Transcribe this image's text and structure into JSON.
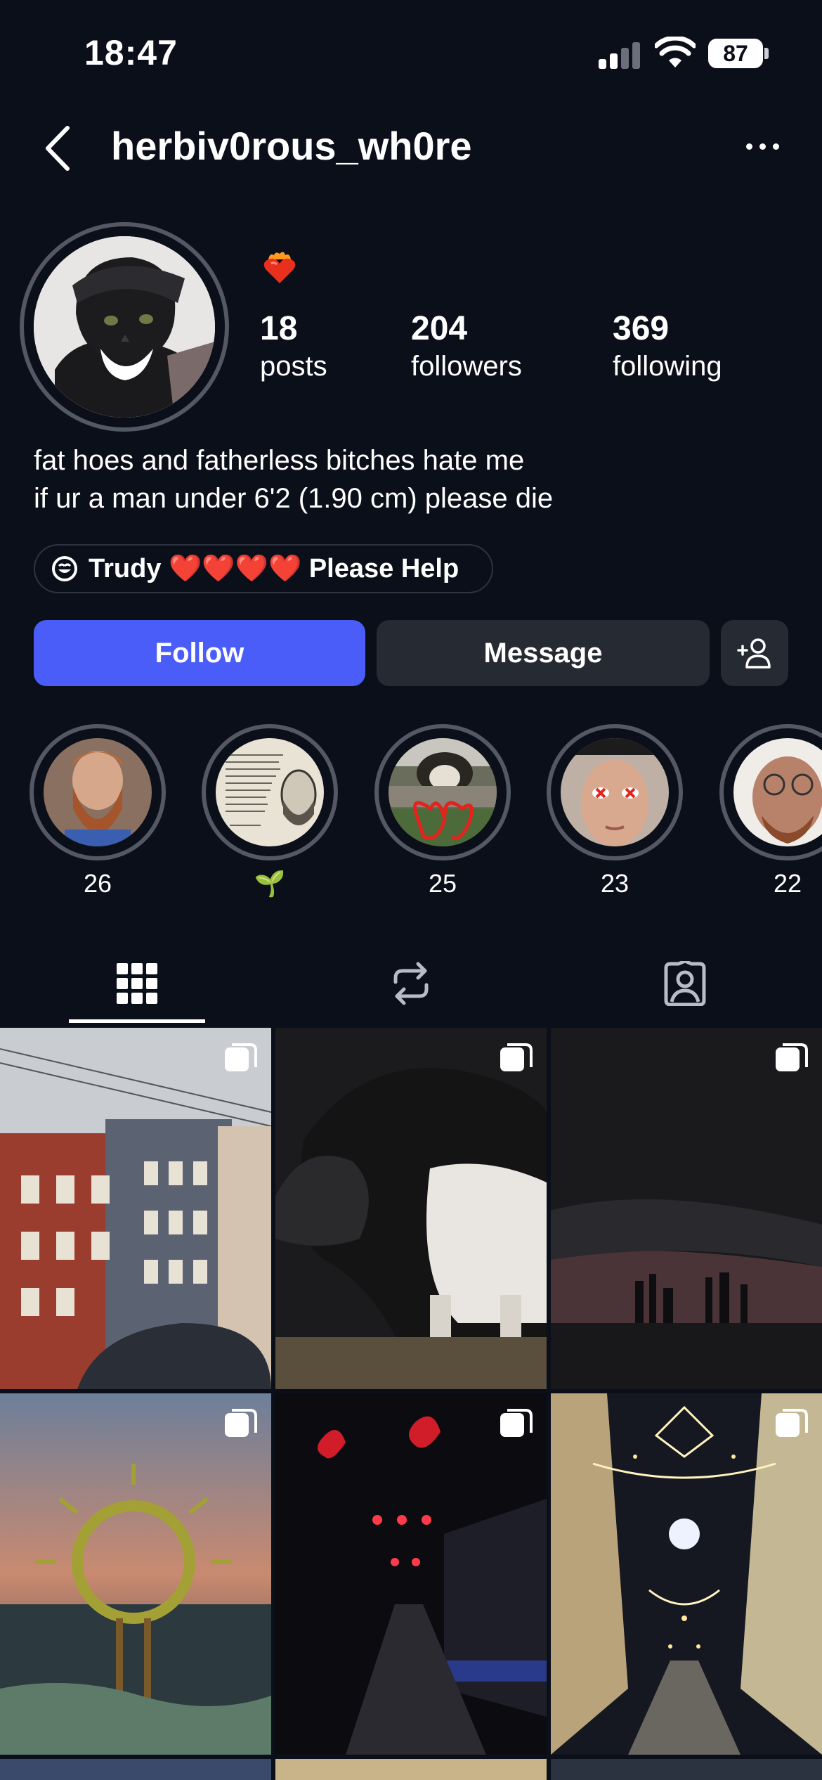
{
  "status_bar": {
    "time": "18:47",
    "battery": "87"
  },
  "header": {
    "username": "herbiv0rous_wh0re",
    "back_icon": "chevron-left-icon",
    "more_icon": "more-horizontal-icon"
  },
  "profile": {
    "note_emoji": "❤️‍🔥",
    "stats": [
      {
        "value": "18",
        "label": "posts"
      },
      {
        "value": "204",
        "label": "followers"
      },
      {
        "value": "369",
        "label": "following"
      }
    ],
    "bio_lines": [
      "fat hoes and fatherless bitches hate me",
      "if ur a man under 6'2 (1.90 cm) please die"
    ],
    "channel": {
      "icon": "channel-icon",
      "text": "Trudy ❤️❤️❤️❤️ Please Help"
    }
  },
  "actions": {
    "follow": "Follow",
    "message": "Message",
    "add_user_icon": "add-user-icon"
  },
  "highlights": [
    {
      "caption": "26"
    },
    {
      "caption": "🌱"
    },
    {
      "caption": "25"
    },
    {
      "caption": "23"
    },
    {
      "caption": "22"
    }
  ],
  "tabs": [
    {
      "name": "grid",
      "icon": "grid-icon",
      "active": true
    },
    {
      "name": "reposts",
      "icon": "repost-icon",
      "active": false
    },
    {
      "name": "tagged",
      "icon": "tagged-icon",
      "active": false
    }
  ],
  "colors": {
    "background": "#0b0f1a",
    "follow": "#4a5df9",
    "secondary_button": "#262a33"
  }
}
